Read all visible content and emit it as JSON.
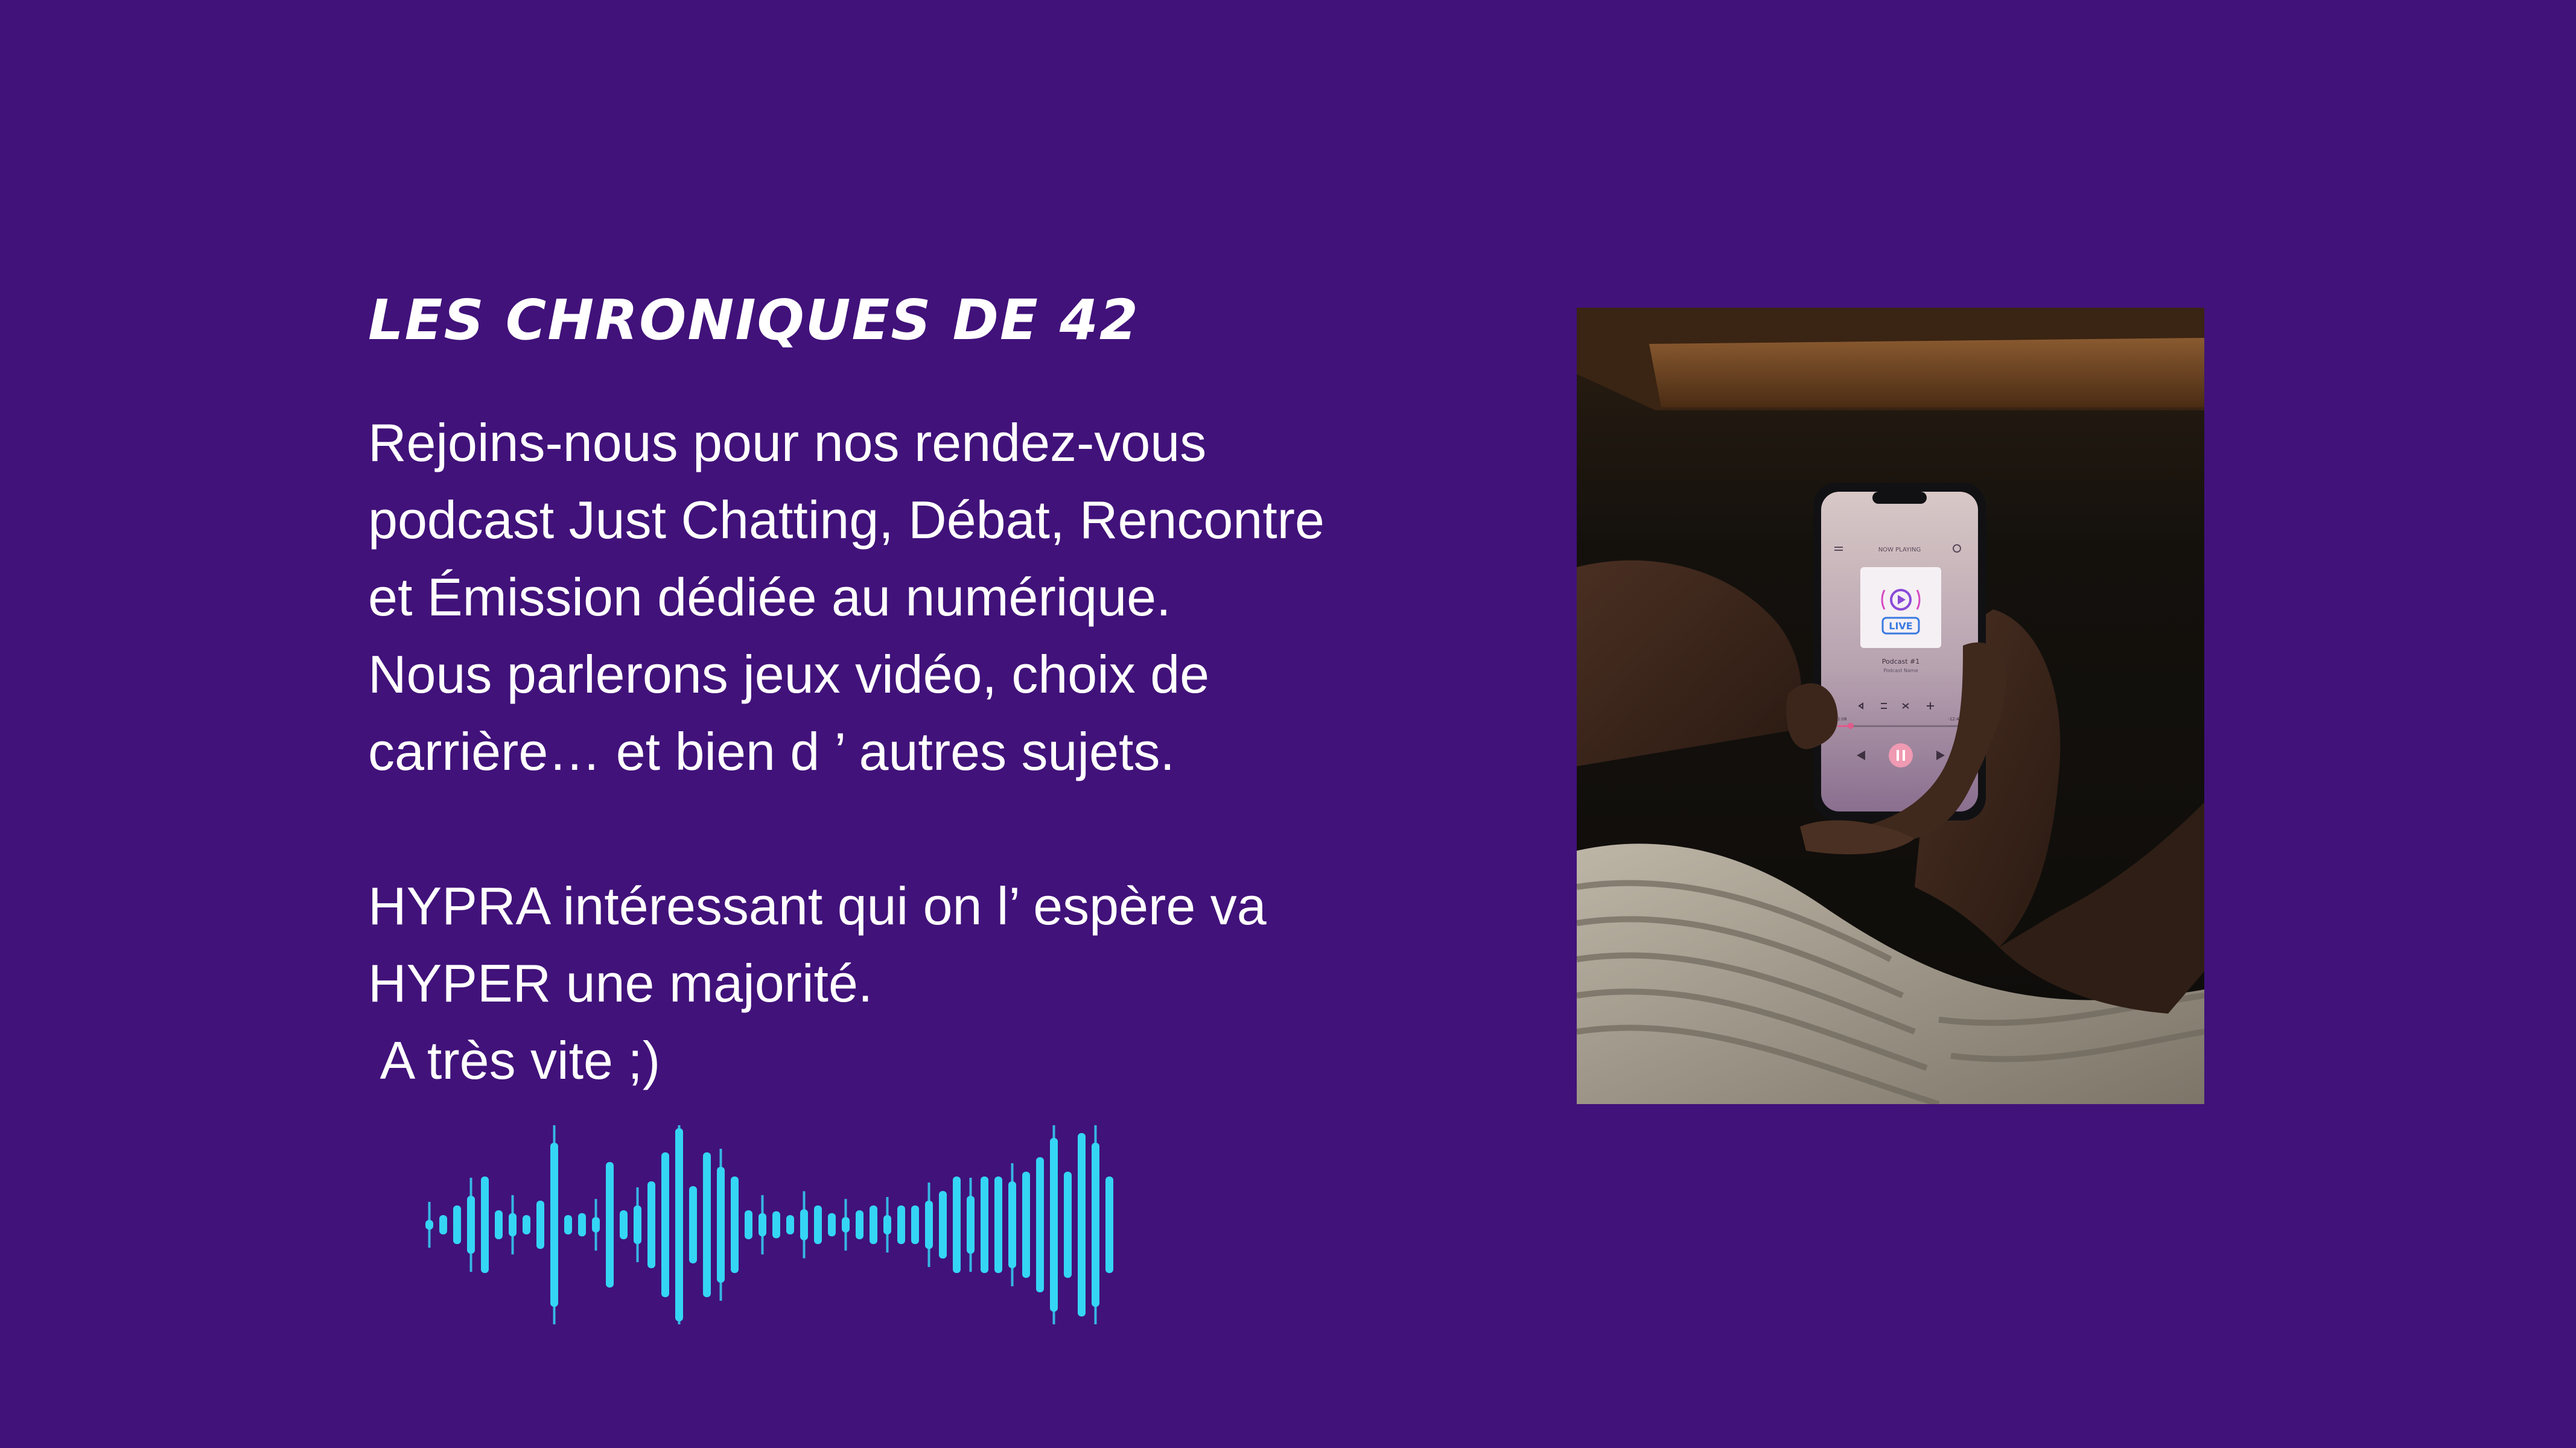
{
  "heading": "LES CHRONIQUES DE 42",
  "paragraph": {
    "lines": [
      "Rejoins-nous pour nos rendez-vous",
      "podcast Just Chatting, Débat, Rencontre",
      "et Émission dédiée au numérique.",
      "Nous parlerons jeux vidéo, choix de",
      "carrière… et bien d ’ autres sujets."
    ],
    "lines2": [
      "HYPRA intéressant qui on l’ espère va",
      "HYPER une majorité.",
      " A très vite ;)"
    ]
  },
  "colors": {
    "background": "#41127a",
    "text": "#ffffff",
    "waveform": "#35d5f4"
  },
  "waveform": {
    "icon": "sound-waveform-icon",
    "levels": [
      0.05,
      0.1,
      0.2,
      0.3,
      0.5,
      0.15,
      0.12,
      0.1,
      0.25,
      0.85,
      0.1,
      0.12,
      0.08,
      0.65,
      0.15,
      0.2,
      0.45,
      0.75,
      1.0,
      0.4,
      0.75,
      0.6,
      0.5,
      0.15,
      0.12,
      0.14,
      0.1,
      0.16,
      0.2,
      0.12,
      0.08,
      0.15,
      0.2,
      0.1,
      0.2,
      0.2,
      0.25,
      0.35,
      0.5,
      0.3,
      0.5,
      0.5,
      0.45,
      0.55,
      0.7,
      0.9,
      0.55,
      0.95,
      0.85,
      0.5
    ]
  },
  "photo": {
    "icon": "podcast-live-phone-photo",
    "phone_screen": {
      "header": "NOW PLAYING",
      "badge": "LIVE",
      "track_title": "Podcast #1",
      "track_subtitle": "Podcast Name",
      "time_elapsed": "1:08",
      "time_total": "-12:40"
    }
  }
}
